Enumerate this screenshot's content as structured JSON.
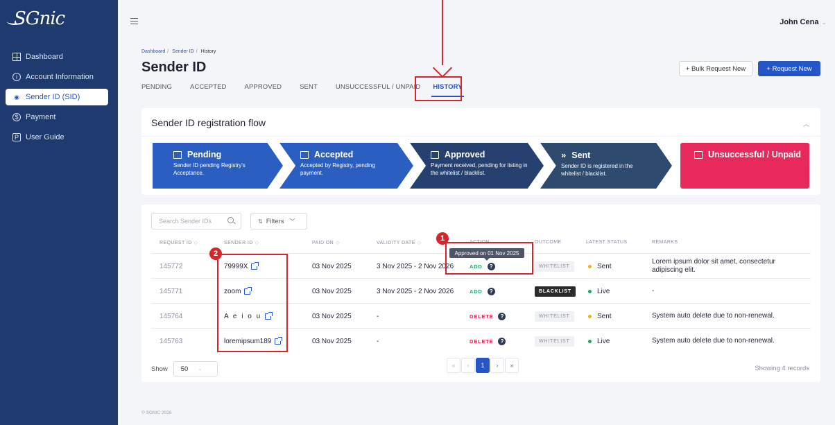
{
  "app": {
    "logo_text": "SGnic",
    "copyright": "© SGNIC 2026"
  },
  "sidebar": {
    "items": [
      {
        "label": "Dashboard",
        "icon": "grid-icon",
        "active": false
      },
      {
        "label": "Account Information",
        "icon": "info-icon",
        "active": false
      },
      {
        "label": "Sender ID (SID)",
        "icon": "signal-icon",
        "active": true
      },
      {
        "label": "Payment",
        "icon": "dollar-icon",
        "active": false
      },
      {
        "label": "User Guide",
        "icon": "book-icon",
        "active": false
      }
    ]
  },
  "header": {
    "user_name": "John Cena",
    "breadcrumb": [
      "Dashboard",
      "Sender ID",
      "History"
    ],
    "title": "Sender ID",
    "bulk_button": "+ Bulk Request New",
    "new_button": "+ Request New",
    "tabs": [
      "PENDING",
      "ACCEPTED",
      "APPROVED",
      "SENT",
      "UNSUCCESSFUL / UNPAID",
      "HISTORY"
    ],
    "active_tab": "HISTORY"
  },
  "flow": {
    "title": "Sender ID registration flow",
    "steps": [
      {
        "title": "Pending",
        "desc": "Sender ID pending Registry's Acceptance."
      },
      {
        "title": "Accepted",
        "desc": "Accepted by Registry, pending payment."
      },
      {
        "title": "Approved",
        "desc": "Payment received, pending for listing in the whitelist / blacklist."
      },
      {
        "title": "Sent",
        "desc": "Sender ID is registered in the whitelist / blacklist."
      },
      {
        "title": "Unsuccessful / Unpaid",
        "desc": ""
      }
    ]
  },
  "table": {
    "search_placeholder": "Search Sender IDs",
    "filters_label": "Filters",
    "columns": [
      "REQUEST ID",
      "SENDER ID",
      "PAID ON",
      "VALIDITY DATE",
      "ACTION",
      "OUTCOME",
      "LATEST STATUS",
      "REMARKS"
    ],
    "rows": [
      {
        "request_id": "145772",
        "sender_id": "79999X",
        "paid_on": "03 Nov 2025",
        "validity": "3 Nov 2025 - 2 Nov 2026",
        "action": "ADD",
        "outcome": "WHITELIST",
        "status": "Sent",
        "remarks": "Lorem ipsum dolor sit amet, consectetur adipiscing elit."
      },
      {
        "request_id": "145771",
        "sender_id": "zoom",
        "paid_on": "03 Nov 2025",
        "validity": "3 Nov 2025 - 2 Nov 2026",
        "action": "ADD",
        "outcome": "BLACKLIST",
        "status": "Live",
        "remarks": "-"
      },
      {
        "request_id": "145764",
        "sender_id": "A e i o u",
        "paid_on": "03 Nov 2025",
        "validity": "-",
        "action": "DELETE",
        "outcome": "WHITELIST",
        "status": "Sent",
        "remarks": "System auto delete due to non-renewal."
      },
      {
        "request_id": "145763",
        "sender_id": "loremipsum189",
        "paid_on": "03 Nov 2025",
        "validity": "-",
        "action": "DELETE",
        "outcome": "WHITELIST",
        "status": "Live",
        "remarks": "System auto delete due to non-renewal."
      }
    ],
    "tooltip": "Approved on 01 Nov 2025",
    "show_label": "Show",
    "page_size": "50",
    "current_page": "1",
    "records_text": "Showing 4 records"
  },
  "annotations": {
    "badge_1": "1",
    "badge_2": "2"
  },
  "colors": {
    "sidebar": "#1e3a6e",
    "primary": "#2456c7",
    "danger": "#e8295d",
    "annotation": "#d7262b"
  }
}
